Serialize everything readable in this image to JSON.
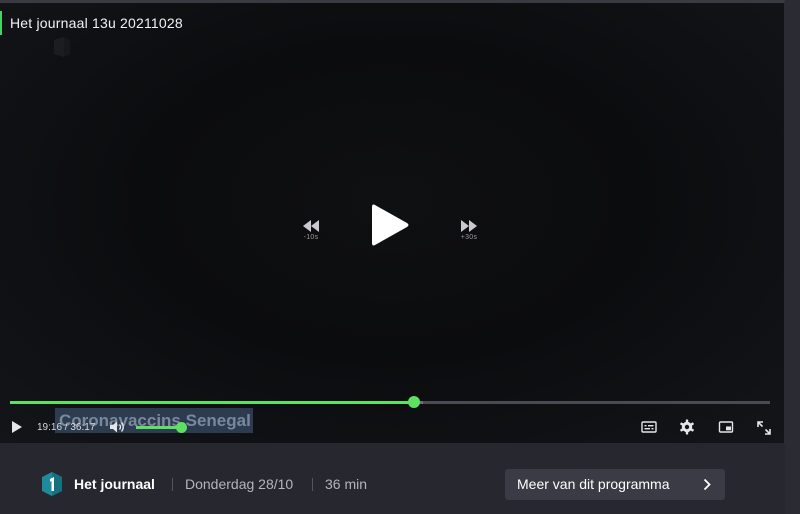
{
  "player": {
    "title": "Het journaal 13u 20211028",
    "rewind_label": "-10s",
    "forward_label": "+30s",
    "caption_text": "Coronavaccins Senegal",
    "current_time": "19:16",
    "duration": "36:17",
    "time_display": "19:16 / 36:17",
    "progress_fraction": 0.531,
    "buffered_fraction": 0.544,
    "volume_fraction": 1.0,
    "accent_color": "#5ee062"
  },
  "icons": {
    "play": "play-icon",
    "rewind": "rewind-10-icon",
    "forward": "forward-30-icon",
    "volume": "volume-icon",
    "subtitles": "subtitles-icon",
    "settings": "gear-icon",
    "pip": "picture-in-picture-icon",
    "fullscreen": "fullscreen-icon",
    "chevron": "chevron-right-icon"
  },
  "program": {
    "name": "Het journaal",
    "date": "Donderdag 28/10",
    "duration": "36 min",
    "more_button_label": "Meer van dit programma",
    "logo_color": "#1f8a99"
  }
}
